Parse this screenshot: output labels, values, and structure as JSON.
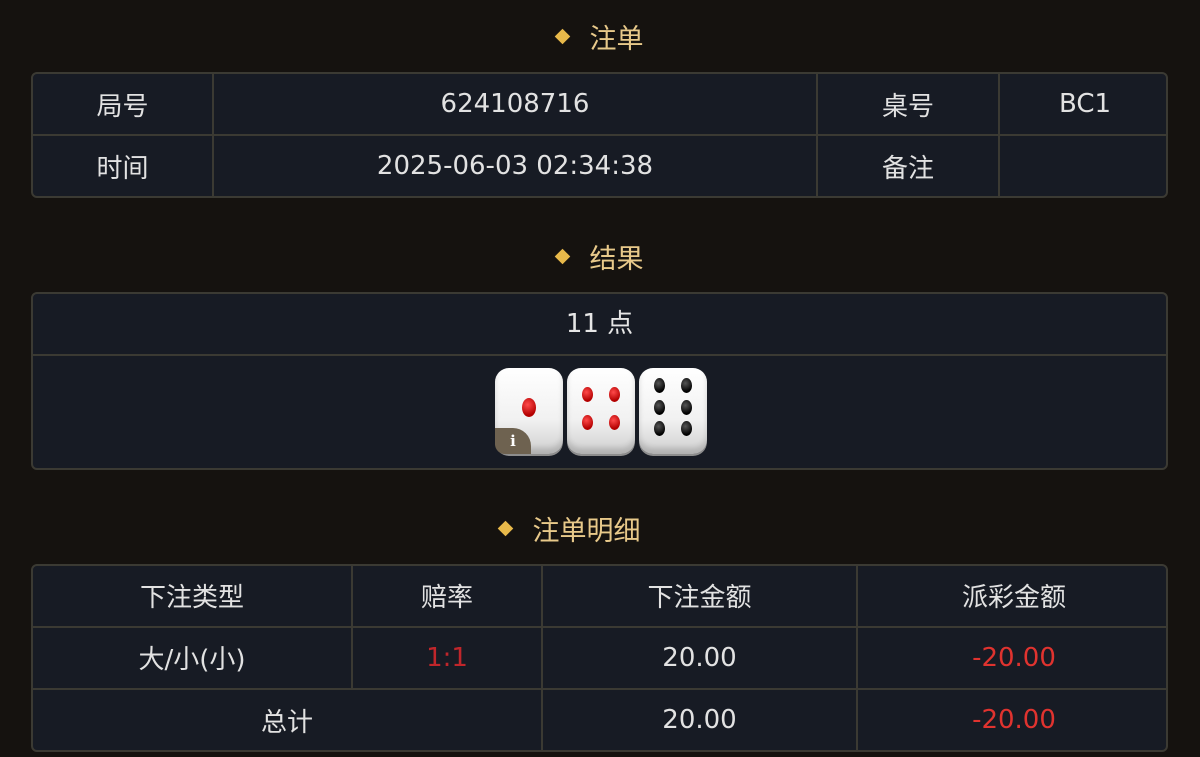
{
  "order_section": {
    "title": "注单",
    "rows": [
      {
        "label1": "局号",
        "value1": "624108716",
        "label2": "桌号",
        "value2": "BC1"
      },
      {
        "label1": "时间",
        "value1": "2025-06-03 02:34:38",
        "label2": "备注",
        "value2": ""
      }
    ]
  },
  "result_section": {
    "title": "结果",
    "points": "11 点",
    "dice": [
      {
        "value": 1,
        "pip_color": "red"
      },
      {
        "value": 4,
        "pip_color": "red"
      },
      {
        "value": 6,
        "pip_color": "black"
      }
    ],
    "info_icon": "i"
  },
  "detail_section": {
    "title": "注单明细",
    "headers": [
      "下注类型",
      "赔率",
      "下注金额",
      "派彩金额"
    ],
    "rows": [
      {
        "type": "大/小(小)",
        "odds": "1:1",
        "bet": "20.00",
        "payout": "-20.00"
      }
    ],
    "total": {
      "label": "总计",
      "bet": "20.00",
      "payout": "-20.00"
    }
  },
  "colors": {
    "accent": "#e8b94a",
    "negative": "#e0332f",
    "odds": "#c0262b"
  }
}
